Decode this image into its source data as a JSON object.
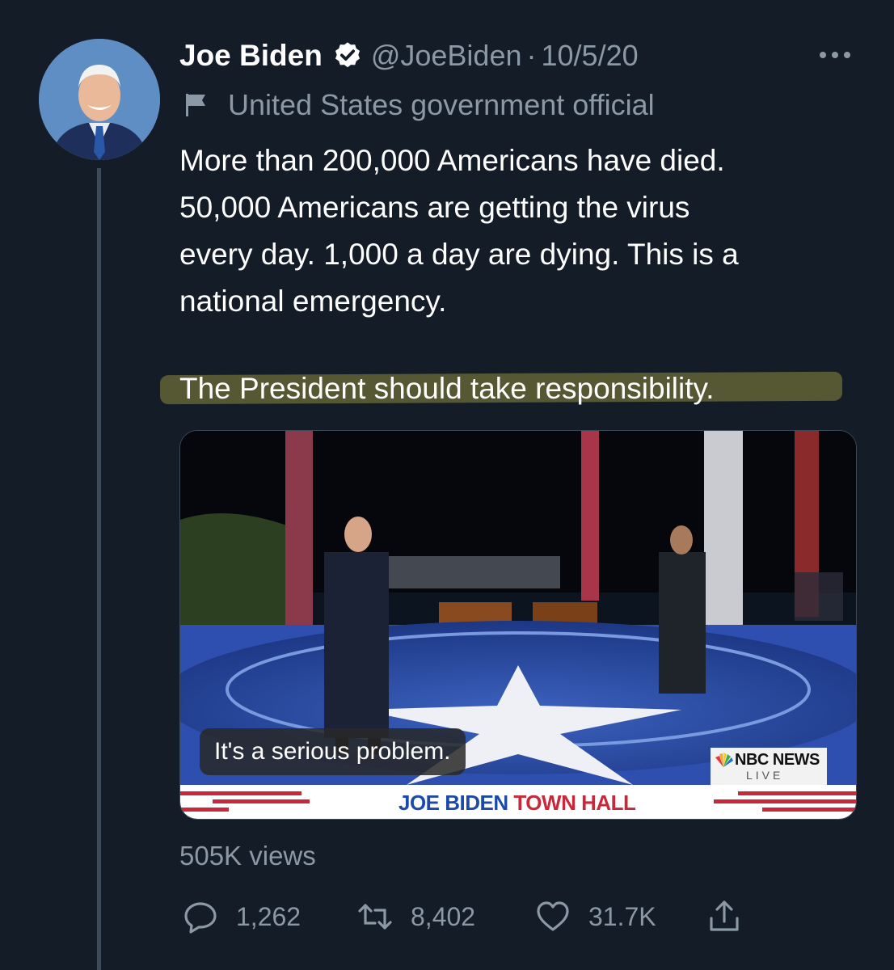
{
  "tweet": {
    "author_name": "Joe Biden",
    "handle": "@JoeBiden",
    "separator": "·",
    "date": "10/5/20",
    "label": "United States government official",
    "text_lines": [
      "More than 200,000 Americans have died.",
      "50,000 Americans are getting the virus",
      "every day. 1,000 a day are dying. This is a",
      "national emergency."
    ],
    "highlighted_line": "The President should take responsibility.",
    "views": "505K views"
  },
  "media": {
    "caption": "It's a serious problem.",
    "banner_blue": "JOE BIDEN",
    "banner_red": "TOWN HALL",
    "network_name": "NBC NEWS",
    "network_live": "LIVE"
  },
  "actions": {
    "replies": "1,262",
    "retweets": "8,402",
    "likes": "31.7K"
  },
  "icons": {
    "verified": "verified-badge-icon",
    "more": "more-options-icon",
    "label": "flag-icon",
    "reply": "reply-icon",
    "retweet": "retweet-icon",
    "like": "heart-icon",
    "share": "share-icon"
  },
  "colors": {
    "background": "#141c28",
    "secondary_text": "#8b98a5",
    "highlight": "#8a8a3c"
  }
}
